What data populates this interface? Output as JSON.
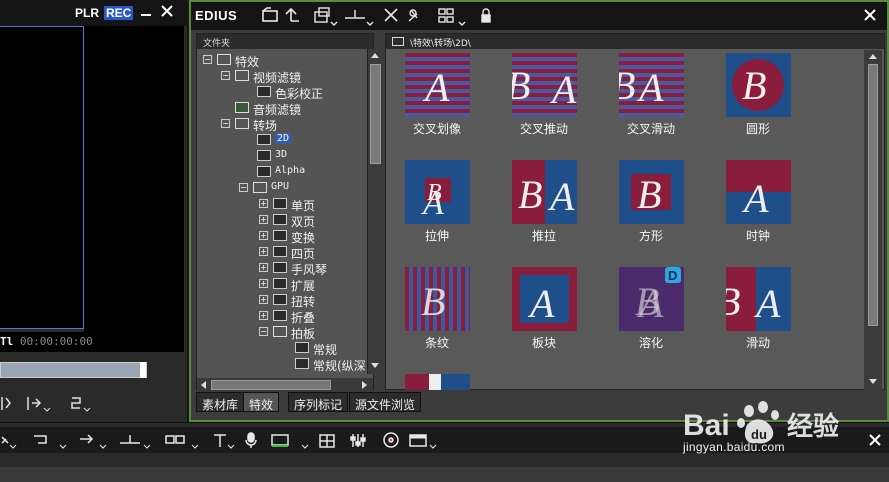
{
  "player": {
    "plr_label": "PLR",
    "rec_label": "REC",
    "timecode_prefix": "Tl",
    "timecode": "00:00:00:00",
    "scrub_position": 0.97
  },
  "bin": {
    "app_title": "EDIUS"
  },
  "tree": {
    "header": "文件夹",
    "items": [
      {
        "label": "特效"
      },
      {
        "label": "视频滤镜"
      },
      {
        "label": "色彩校正"
      },
      {
        "label": "音频滤镜"
      },
      {
        "label": "转场"
      },
      {
        "label": "2D"
      },
      {
        "label": "3D"
      },
      {
        "label": "Alpha"
      },
      {
        "label": "GPU"
      },
      {
        "label": "单页"
      },
      {
        "label": "双页"
      },
      {
        "label": "变换"
      },
      {
        "label": "四页"
      },
      {
        "label": "手风琴"
      },
      {
        "label": "扩展"
      },
      {
        "label": "扭转"
      },
      {
        "label": "折叠"
      },
      {
        "label": "拍板"
      },
      {
        "label": "常规"
      },
      {
        "label": "常规(纵深"
      }
    ]
  },
  "tabs": [
    {
      "label": "素材库"
    },
    {
      "label": "特效"
    },
    {
      "label": "序列标记"
    },
    {
      "label": "源文件浏览"
    }
  ],
  "effects": {
    "path": "\\特效\\转场\\2D\\",
    "items": [
      {
        "label": "交叉划像"
      },
      {
        "label": "交叉推动"
      },
      {
        "label": "交叉滑动"
      },
      {
        "label": "圆形"
      },
      {
        "label": "拉伸"
      },
      {
        "label": "推拉"
      },
      {
        "label": "方形"
      },
      {
        "label": "时钟"
      },
      {
        "label": "条纹"
      },
      {
        "label": "板块"
      },
      {
        "label": "溶化"
      },
      {
        "label": "滑动"
      }
    ],
    "thumb_letters": [
      "A",
      "B",
      "D"
    ]
  },
  "watermark": {
    "brand": "Bai",
    "brand_tail": "经验",
    "logo_letters": "du",
    "url": "jingyan.baidu.com"
  },
  "colors": {
    "accent_blue": "#1e4f8a",
    "accent_red": "#8a1c3c",
    "window_border": "#5a8a3c"
  }
}
